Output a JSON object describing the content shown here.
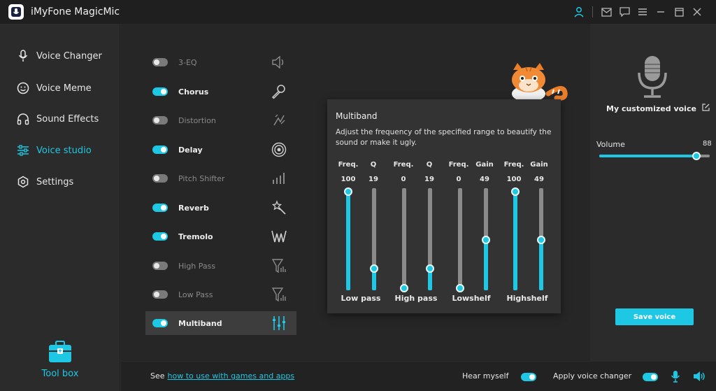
{
  "app": {
    "title": "iMyFone MagicMic"
  },
  "titlebar": {
    "icons": [
      "user-icon",
      "mail-icon",
      "chat-icon",
      "menu-icon",
      "minimize-icon",
      "maximize-icon",
      "close-icon"
    ]
  },
  "sidebar": {
    "items": [
      {
        "label": "Voice Changer",
        "icon": "microphone-icon",
        "active": false
      },
      {
        "label": "Voice Meme",
        "icon": "smiley-icon",
        "active": false
      },
      {
        "label": "Sound Effects",
        "icon": "headphones-icon",
        "active": false
      },
      {
        "label": "Voice studio",
        "icon": "sliders-icon",
        "active": true
      },
      {
        "label": "Settings",
        "icon": "gear-icon",
        "active": false
      }
    ],
    "toolbox_label": "Tool box"
  },
  "effects": [
    {
      "label": "3-EQ",
      "on": false,
      "icon": "speaker-icon"
    },
    {
      "label": "Chorus",
      "on": true,
      "icon": "microphone-icon"
    },
    {
      "label": "Distortion",
      "on": false,
      "icon": "distortion-icon"
    },
    {
      "label": "Delay",
      "on": true,
      "icon": "rings-icon"
    },
    {
      "label": "Pitch Shifter",
      "on": false,
      "icon": "bars-icon"
    },
    {
      "label": "Reverb",
      "on": true,
      "icon": "sparkle-wand-icon"
    },
    {
      "label": "Tremolo",
      "on": true,
      "icon": "wave-icon"
    },
    {
      "label": "High Pass",
      "on": false,
      "icon": "funnel-icon"
    },
    {
      "label": "Low Pass",
      "on": false,
      "icon": "funnel-icon"
    },
    {
      "label": "Multiband",
      "on": true,
      "icon": "equalizer-icon",
      "selected": true
    }
  ],
  "multiband": {
    "title": "Multiband",
    "description": "Adjust the frequency of the specified range to beautify the sound or make it ugly.",
    "bands": [
      {
        "label": "Low pass",
        "params": [
          {
            "name": "Freq.",
            "value": "100",
            "level": 1.0
          },
          {
            "name": "Q",
            "value": "19",
            "level": 0.2
          }
        ]
      },
      {
        "label": "High pass",
        "params": [
          {
            "name": "Freq.",
            "value": "0",
            "level": 0.0
          },
          {
            "name": "Q",
            "value": "19",
            "level": 0.2
          }
        ]
      },
      {
        "label": "Lowshelf",
        "params": [
          {
            "name": "Freq.",
            "value": "0",
            "level": 0.0
          },
          {
            "name": "Gain",
            "value": "49",
            "level": 0.5
          }
        ]
      },
      {
        "label": "Highshelf",
        "params": [
          {
            "name": "Freq.",
            "value": "100",
            "level": 1.0
          },
          {
            "name": "Gain",
            "value": "49",
            "level": 0.5
          }
        ]
      }
    ]
  },
  "right": {
    "custom_voice_label": "My customized voice",
    "volume_label": "Volume",
    "volume_value": "88",
    "volume_level": 0.88,
    "save_label": "Save voice"
  },
  "bottom": {
    "see_prefix": "See",
    "see_link": "how to use with games and apps",
    "hear_myself": "Hear myself",
    "apply_changer": "Apply voice changer"
  },
  "colors": {
    "accent": "#1ec8e4",
    "background": "#2b2b2b",
    "panel": "#333333"
  }
}
